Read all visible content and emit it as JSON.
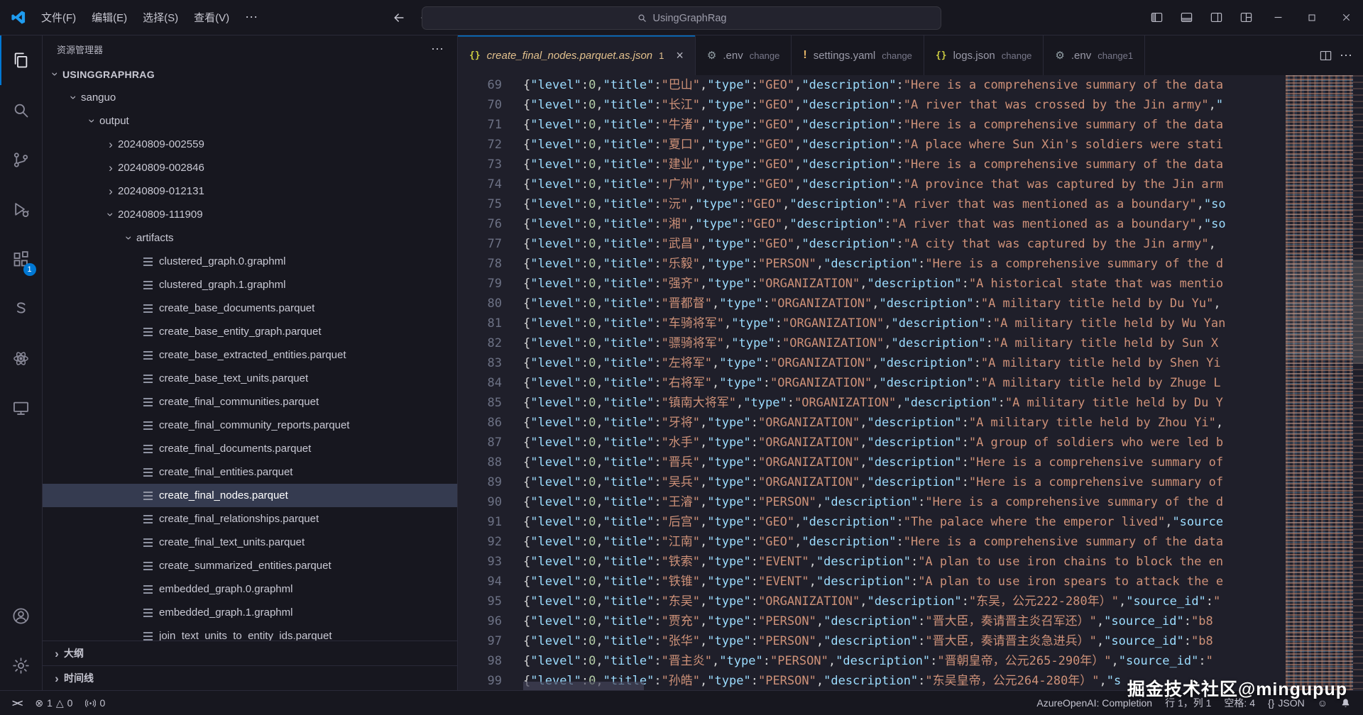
{
  "titlebar": {
    "menus": [
      "文件(F)",
      "编辑(E)",
      "选择(S)",
      "查看(V)"
    ],
    "search": "UsingGraphRag"
  },
  "icons": {
    "json": "{}",
    "yaml": "!",
    "gear": "⚙",
    "close": "×",
    "chevron": "›",
    "ellipsis": "⋯",
    "error": "⊗",
    "warning": "△",
    "feedback": "☺"
  },
  "activitybar": {
    "extensions_badge": "1"
  },
  "explorer": {
    "title": "资源管理器",
    "outline": "大纲",
    "timeline": "时间线",
    "items": [
      {
        "label": "USINGGRAPHRAG",
        "indent": 0,
        "kind": "root",
        "state": "open"
      },
      {
        "label": "sanguo",
        "indent": 1,
        "kind": "folder",
        "state": "open"
      },
      {
        "label": "output",
        "indent": 2,
        "kind": "folder",
        "state": "open"
      },
      {
        "label": "20240809-002559",
        "indent": 3,
        "kind": "folder",
        "state": "closed"
      },
      {
        "label": "20240809-002846",
        "indent": 3,
        "kind": "folder",
        "state": "closed"
      },
      {
        "label": "20240809-012131",
        "indent": 3,
        "kind": "folder",
        "state": "closed"
      },
      {
        "label": "20240809-111909",
        "indent": 3,
        "kind": "folder",
        "state": "open"
      },
      {
        "label": "artifacts",
        "indent": 4,
        "kind": "folder",
        "state": "open"
      },
      {
        "label": "clustered_graph.0.graphml",
        "indent": 5,
        "kind": "file"
      },
      {
        "label": "clustered_graph.1.graphml",
        "indent": 5,
        "kind": "file"
      },
      {
        "label": "create_base_documents.parquet",
        "indent": 5,
        "kind": "file"
      },
      {
        "label": "create_base_entity_graph.parquet",
        "indent": 5,
        "kind": "file"
      },
      {
        "label": "create_base_extracted_entities.parquet",
        "indent": 5,
        "kind": "file"
      },
      {
        "label": "create_base_text_units.parquet",
        "indent": 5,
        "kind": "file"
      },
      {
        "label": "create_final_communities.parquet",
        "indent": 5,
        "kind": "file"
      },
      {
        "label": "create_final_community_reports.parquet",
        "indent": 5,
        "kind": "file"
      },
      {
        "label": "create_final_documents.parquet",
        "indent": 5,
        "kind": "file"
      },
      {
        "label": "create_final_entities.parquet",
        "indent": 5,
        "kind": "file"
      },
      {
        "label": "create_final_nodes.parquet",
        "indent": 5,
        "kind": "file",
        "selected": true
      },
      {
        "label": "create_final_relationships.parquet",
        "indent": 5,
        "kind": "file"
      },
      {
        "label": "create_final_text_units.parquet",
        "indent": 5,
        "kind": "file"
      },
      {
        "label": "create_summarized_entities.parquet",
        "indent": 5,
        "kind": "file"
      },
      {
        "label": "embedded_graph.0.graphml",
        "indent": 5,
        "kind": "file"
      },
      {
        "label": "embedded_graph.1.graphml",
        "indent": 5,
        "kind": "file"
      },
      {
        "label": "join_text_units_to_entity_ids.parquet",
        "indent": 5,
        "kind": "file"
      }
    ]
  },
  "tabs": [
    {
      "name": "create_final_nodes.parquet.as.json",
      "desc": "",
      "badge": "1",
      "icon": "json",
      "active": true
    },
    {
      "name": ".env",
      "desc": "change",
      "icon": "gear"
    },
    {
      "name": "settings.yaml",
      "desc": "change",
      "icon": "yaml"
    },
    {
      "name": "logs.json",
      "desc": "change",
      "icon": "json"
    },
    {
      "name": ".env",
      "desc": "change1",
      "icon": "gear"
    }
  ],
  "editor": {
    "lines": [
      {
        "num": "69",
        "level": "0",
        "title": "巴山",
        "type": "GEO",
        "desc": "Here is a comprehensive summary of the data",
        "closed": false,
        "suffix": []
      },
      {
        "num": "70",
        "level": "0",
        "title": "长江",
        "type": "GEO",
        "desc": "A river that was crossed by the Jin army",
        "closed": true,
        "suffix": [
          [
            "p",
            ","
          ],
          [
            "k",
            "\""
          ]
        ]
      },
      {
        "num": "71",
        "level": "0",
        "title": "牛渚",
        "type": "GEO",
        "desc": "Here is a comprehensive summary of the data",
        "closed": false,
        "suffix": []
      },
      {
        "num": "72",
        "level": "0",
        "title": "夏口",
        "type": "GEO",
        "desc": "A place where Sun Xin's soldiers were stati",
        "closed": false,
        "suffix": []
      },
      {
        "num": "73",
        "level": "0",
        "title": "建业",
        "type": "GEO",
        "desc": "Here is a comprehensive summary of the data",
        "closed": false,
        "suffix": []
      },
      {
        "num": "74",
        "level": "0",
        "title": "广州",
        "type": "GEO",
        "desc": "A province that was captured by the Jin arm",
        "closed": false,
        "suffix": []
      },
      {
        "num": "75",
        "level": "0",
        "title": "沅",
        "type": "GEO",
        "desc": "A river that was mentioned as a boundary",
        "closed": true,
        "suffix": [
          [
            "p",
            ","
          ],
          [
            "k",
            "\"so"
          ]
        ]
      },
      {
        "num": "76",
        "level": "0",
        "title": "湘",
        "type": "GEO",
        "desc": "A river that was mentioned as a boundary",
        "closed": true,
        "suffix": [
          [
            "p",
            ","
          ],
          [
            "k",
            "\"so"
          ]
        ]
      },
      {
        "num": "77",
        "level": "0",
        "title": "武昌",
        "type": "GEO",
        "desc": "A city that was captured by the Jin army",
        "closed": true,
        "suffix": [
          [
            "p",
            ","
          ]
        ]
      },
      {
        "num": "78",
        "level": "0",
        "title": "乐毅",
        "type": "PERSON",
        "desc": "Here is a comprehensive summary of the d",
        "closed": false,
        "suffix": []
      },
      {
        "num": "79",
        "level": "0",
        "title": "强齐",
        "type": "ORGANIZATION",
        "desc": "A historical state that was mentio",
        "closed": false,
        "suffix": []
      },
      {
        "num": "80",
        "level": "0",
        "title": "晋都督",
        "type": "ORGANIZATION",
        "desc": "A military title held by Du Yu",
        "closed": true,
        "suffix": [
          [
            "p",
            ","
          ]
        ]
      },
      {
        "num": "81",
        "level": "0",
        "title": "车骑将军",
        "type": "ORGANIZATION",
        "desc": "A military title held by Wu Yan",
        "closed": false,
        "suffix": []
      },
      {
        "num": "82",
        "level": "0",
        "title": "骠骑将军",
        "type": "ORGANIZATION",
        "desc": "A military title held by Sun X",
        "closed": false,
        "suffix": []
      },
      {
        "num": "83",
        "level": "0",
        "title": "左将军",
        "type": "ORGANIZATION",
        "desc": "A military title held by Shen Yi",
        "closed": false,
        "suffix": []
      },
      {
        "num": "84",
        "level": "0",
        "title": "右将军",
        "type": "ORGANIZATION",
        "desc": "A military title held by Zhuge L",
        "closed": false,
        "suffix": []
      },
      {
        "num": "85",
        "level": "0",
        "title": "镇南大将军",
        "type": "ORGANIZATION",
        "desc": "A military title held by Du Y",
        "closed": false,
        "suffix": []
      },
      {
        "num": "86",
        "level": "0",
        "title": "牙将",
        "type": "ORGANIZATION",
        "desc": "A military title held by Zhou Yi",
        "closed": true,
        "suffix": [
          [
            "p",
            ","
          ]
        ]
      },
      {
        "num": "87",
        "level": "0",
        "title": "水手",
        "type": "ORGANIZATION",
        "desc": "A group of soldiers who were led b",
        "closed": false,
        "suffix": []
      },
      {
        "num": "88",
        "level": "0",
        "title": "晋兵",
        "type": "ORGANIZATION",
        "desc": "Here is a comprehensive summary of",
        "closed": false,
        "suffix": []
      },
      {
        "num": "89",
        "level": "0",
        "title": "吴兵",
        "type": "ORGANIZATION",
        "desc": "Here is a comprehensive summary of",
        "closed": false,
        "suffix": []
      },
      {
        "num": "90",
        "level": "0",
        "title": "王濬",
        "type": "PERSON",
        "desc": "Here is a comprehensive summary of the d",
        "closed": false,
        "suffix": []
      },
      {
        "num": "91",
        "level": "0",
        "title": "后宫",
        "type": "GEO",
        "desc": "The palace where the emperor lived",
        "closed": true,
        "suffix": [
          [
            "p",
            ","
          ],
          [
            "k",
            "\"source"
          ]
        ]
      },
      {
        "num": "92",
        "level": "0",
        "title": "江南",
        "type": "GEO",
        "desc": "Here is a comprehensive summary of the data",
        "closed": false,
        "suffix": []
      },
      {
        "num": "93",
        "level": "0",
        "title": "铁索",
        "type": "EVENT",
        "desc": "A plan to use iron chains to block the en",
        "closed": false,
        "suffix": []
      },
      {
        "num": "94",
        "level": "0",
        "title": "铁锥",
        "type": "EVENT",
        "desc": "A plan to use iron spears to attack the e",
        "closed": false,
        "suffix": []
      },
      {
        "num": "95",
        "level": "0",
        "title": "东吴",
        "type": "ORGANIZATION",
        "desc": "东吴，公元222-280年）",
        "closed": true,
        "suffix": [
          [
            "p",
            ","
          ],
          [
            "k",
            "\"source_id\""
          ],
          [
            "p",
            ":"
          ],
          [
            "s",
            "\""
          ]
        ]
      },
      {
        "num": "96",
        "level": "0",
        "title": "贾充",
        "type": "PERSON",
        "desc": "晋大臣，奏请晋主炎召军还）",
        "closed": true,
        "suffix": [
          [
            "p",
            ","
          ],
          [
            "k",
            "\"source_id\""
          ],
          [
            "p",
            ":"
          ],
          [
            "s",
            "\"b8"
          ]
        ]
      },
      {
        "num": "97",
        "level": "0",
        "title": "张华",
        "type": "PERSON",
        "desc": "晋大臣，奏请晋主炎急进兵）",
        "closed": true,
        "suffix": [
          [
            "p",
            ","
          ],
          [
            "k",
            "\"source_id\""
          ],
          [
            "p",
            ":"
          ],
          [
            "s",
            "\"b8"
          ]
        ]
      },
      {
        "num": "98",
        "level": "0",
        "title": "晋主炎",
        "type": "PERSON",
        "desc": "晋朝皇帝，公元265-290年）",
        "closed": true,
        "suffix": [
          [
            "p",
            ","
          ],
          [
            "k",
            "\"source_id\""
          ],
          [
            "p",
            ":"
          ],
          [
            "s",
            "\""
          ]
        ]
      },
      {
        "num": "99",
        "level": "0",
        "title": "孙皓",
        "type": "PERSON",
        "desc": "东吴皇帝，公元264-280年）",
        "closed": true,
        "suffix": [
          [
            "p",
            ","
          ],
          [
            "k",
            "\"s"
          ]
        ]
      }
    ]
  },
  "statusbar": {
    "errors": "1",
    "warnings": "0",
    "ports": "0",
    "ai": "AzureOpenAI: Completion",
    "cursor": "行 1，列 1",
    "indent": "空格: 4",
    "lang_icon": "{}",
    "lang": "JSON"
  },
  "watermark": "掘金技术社区@mingupup"
}
